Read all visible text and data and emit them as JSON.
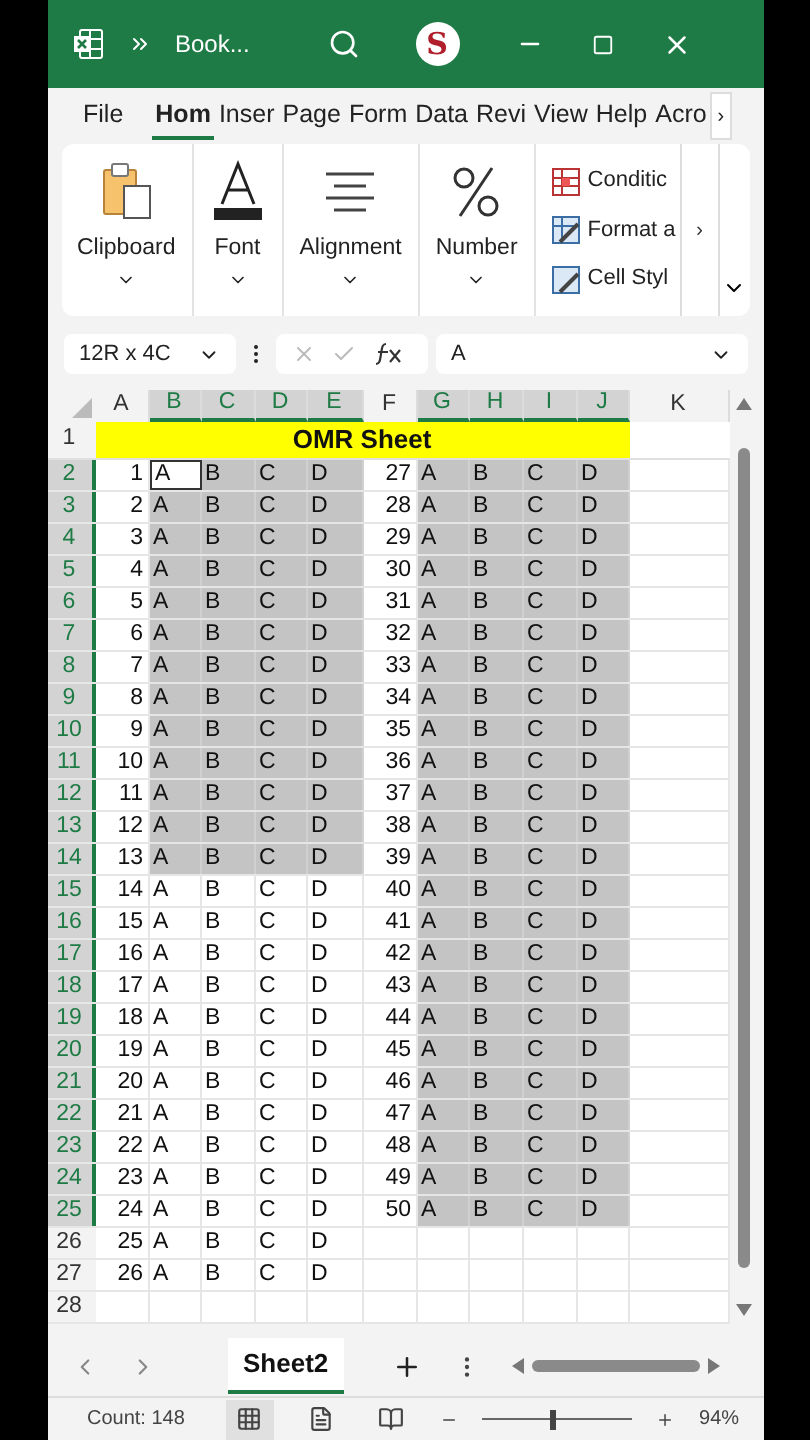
{
  "window": {
    "title": "Book...",
    "avatar": "S"
  },
  "tabs": [
    {
      "label": "File",
      "selected": false
    },
    {
      "label": "Hom",
      "selected": true
    },
    {
      "label": "Inser",
      "selected": false
    },
    {
      "label": "Page",
      "selected": false
    },
    {
      "label": "Form",
      "selected": false
    },
    {
      "label": "Data",
      "selected": false
    },
    {
      "label": "Revi",
      "selected": false
    },
    {
      "label": "View",
      "selected": false
    },
    {
      "label": "Help",
      "selected": false
    },
    {
      "label": "Acro",
      "selected": false
    }
  ],
  "tabs_more": "›",
  "ribbon": {
    "groups": [
      {
        "kind": "clipboard",
        "label": "Clipboard"
      },
      {
        "kind": "font",
        "label": "Font"
      },
      {
        "kind": "alignment",
        "label": "Alignment"
      },
      {
        "kind": "number",
        "label": "Number"
      }
    ],
    "styles": [
      {
        "kind": "conditional",
        "label": "Conditic"
      },
      {
        "kind": "table",
        "label": "Format a"
      },
      {
        "kind": "cell",
        "label": "Cell Styl"
      }
    ],
    "more": "›"
  },
  "formula_bar": {
    "name_box": "12R x 4C",
    "value": "A"
  },
  "sheet": {
    "columns": [
      {
        "label": "A",
        "selected": false
      },
      {
        "label": "B",
        "selected": true
      },
      {
        "label": "C",
        "selected": true
      },
      {
        "label": "D",
        "selected": true
      },
      {
        "label": "E",
        "selected": true
      },
      {
        "label": "F",
        "selected": false
      },
      {
        "label": "G",
        "selected": true
      },
      {
        "label": "H",
        "selected": true
      },
      {
        "label": "I",
        "selected": true
      },
      {
        "label": "J",
        "selected": true
      },
      {
        "label": "K",
        "selected": false
      }
    ],
    "title_row": {
      "label": "1",
      "selected": false,
      "text": "OMR Sheet"
    },
    "rows": [
      {
        "label": "2",
        "selected": true,
        "cells": [
          {
            "text": "1",
            "selected": false,
            "active": false
          },
          {
            "text": "A",
            "selected": true,
            "active": true
          },
          {
            "text": "B",
            "selected": true,
            "active": false
          },
          {
            "text": "C",
            "selected": true,
            "active": false
          },
          {
            "text": "D",
            "selected": true,
            "active": false
          },
          {
            "text": "27",
            "selected": false,
            "active": false
          },
          {
            "text": "A",
            "selected": true,
            "active": false
          },
          {
            "text": "B",
            "selected": true,
            "active": false
          },
          {
            "text": "C",
            "selected": true,
            "active": false
          },
          {
            "text": "D",
            "selected": true,
            "active": false
          }
        ]
      },
      {
        "label": "3",
        "selected": true,
        "cells": [
          {
            "text": "2",
            "selected": false,
            "active": false
          },
          {
            "text": "A",
            "selected": true,
            "active": false
          },
          {
            "text": "B",
            "selected": true,
            "active": false
          },
          {
            "text": "C",
            "selected": true,
            "active": false
          },
          {
            "text": "D",
            "selected": true,
            "active": false
          },
          {
            "text": "28",
            "selected": false,
            "active": false
          },
          {
            "text": "A",
            "selected": true,
            "active": false
          },
          {
            "text": "B",
            "selected": true,
            "active": false
          },
          {
            "text": "C",
            "selected": true,
            "active": false
          },
          {
            "text": "D",
            "selected": true,
            "active": false
          }
        ]
      },
      {
        "label": "4",
        "selected": true,
        "cells": [
          {
            "text": "3",
            "selected": false,
            "active": false
          },
          {
            "text": "A",
            "selected": true,
            "active": false
          },
          {
            "text": "B",
            "selected": true,
            "active": false
          },
          {
            "text": "C",
            "selected": true,
            "active": false
          },
          {
            "text": "D",
            "selected": true,
            "active": false
          },
          {
            "text": "29",
            "selected": false,
            "active": false
          },
          {
            "text": "A",
            "selected": true,
            "active": false
          },
          {
            "text": "B",
            "selected": true,
            "active": false
          },
          {
            "text": "C",
            "selected": true,
            "active": false
          },
          {
            "text": "D",
            "selected": true,
            "active": false
          }
        ]
      },
      {
        "label": "5",
        "selected": true,
        "cells": [
          {
            "text": "4",
            "selected": false,
            "active": false
          },
          {
            "text": "A",
            "selected": true,
            "active": false
          },
          {
            "text": "B",
            "selected": true,
            "active": false
          },
          {
            "text": "C",
            "selected": true,
            "active": false
          },
          {
            "text": "D",
            "selected": true,
            "active": false
          },
          {
            "text": "30",
            "selected": false,
            "active": false
          },
          {
            "text": "A",
            "selected": true,
            "active": false
          },
          {
            "text": "B",
            "selected": true,
            "active": false
          },
          {
            "text": "C",
            "selected": true,
            "active": false
          },
          {
            "text": "D",
            "selected": true,
            "active": false
          }
        ]
      },
      {
        "label": "6",
        "selected": true,
        "cells": [
          {
            "text": "5",
            "selected": false,
            "active": false
          },
          {
            "text": "A",
            "selected": true,
            "active": false
          },
          {
            "text": "B",
            "selected": true,
            "active": false
          },
          {
            "text": "C",
            "selected": true,
            "active": false
          },
          {
            "text": "D",
            "selected": true,
            "active": false
          },
          {
            "text": "31",
            "selected": false,
            "active": false
          },
          {
            "text": "A",
            "selected": true,
            "active": false
          },
          {
            "text": "B",
            "selected": true,
            "active": false
          },
          {
            "text": "C",
            "selected": true,
            "active": false
          },
          {
            "text": "D",
            "selected": true,
            "active": false
          }
        ]
      },
      {
        "label": "7",
        "selected": true,
        "cells": [
          {
            "text": "6",
            "selected": false,
            "active": false
          },
          {
            "text": "A",
            "selected": true,
            "active": false
          },
          {
            "text": "B",
            "selected": true,
            "active": false
          },
          {
            "text": "C",
            "selected": true,
            "active": false
          },
          {
            "text": "D",
            "selected": true,
            "active": false
          },
          {
            "text": "32",
            "selected": false,
            "active": false
          },
          {
            "text": "A",
            "selected": true,
            "active": false
          },
          {
            "text": "B",
            "selected": true,
            "active": false
          },
          {
            "text": "C",
            "selected": true,
            "active": false
          },
          {
            "text": "D",
            "selected": true,
            "active": false
          }
        ]
      },
      {
        "label": "8",
        "selected": true,
        "cells": [
          {
            "text": "7",
            "selected": false,
            "active": false
          },
          {
            "text": "A",
            "selected": true,
            "active": false
          },
          {
            "text": "B",
            "selected": true,
            "active": false
          },
          {
            "text": "C",
            "selected": true,
            "active": false
          },
          {
            "text": "D",
            "selected": true,
            "active": false
          },
          {
            "text": "33",
            "selected": false,
            "active": false
          },
          {
            "text": "A",
            "selected": true,
            "active": false
          },
          {
            "text": "B",
            "selected": true,
            "active": false
          },
          {
            "text": "C",
            "selected": true,
            "active": false
          },
          {
            "text": "D",
            "selected": true,
            "active": false
          }
        ]
      },
      {
        "label": "9",
        "selected": true,
        "cells": [
          {
            "text": "8",
            "selected": false,
            "active": false
          },
          {
            "text": "A",
            "selected": true,
            "active": false
          },
          {
            "text": "B",
            "selected": true,
            "active": false
          },
          {
            "text": "C",
            "selected": true,
            "active": false
          },
          {
            "text": "D",
            "selected": true,
            "active": false
          },
          {
            "text": "34",
            "selected": false,
            "active": false
          },
          {
            "text": "A",
            "selected": true,
            "active": false
          },
          {
            "text": "B",
            "selected": true,
            "active": false
          },
          {
            "text": "C",
            "selected": true,
            "active": false
          },
          {
            "text": "D",
            "selected": true,
            "active": false
          }
        ]
      },
      {
        "label": "10",
        "selected": true,
        "cells": [
          {
            "text": "9",
            "selected": false,
            "active": false
          },
          {
            "text": "A",
            "selected": true,
            "active": false
          },
          {
            "text": "B",
            "selected": true,
            "active": false
          },
          {
            "text": "C",
            "selected": true,
            "active": false
          },
          {
            "text": "D",
            "selected": true,
            "active": false
          },
          {
            "text": "35",
            "selected": false,
            "active": false
          },
          {
            "text": "A",
            "selected": true,
            "active": false
          },
          {
            "text": "B",
            "selected": true,
            "active": false
          },
          {
            "text": "C",
            "selected": true,
            "active": false
          },
          {
            "text": "D",
            "selected": true,
            "active": false
          }
        ]
      },
      {
        "label": "11",
        "selected": true,
        "cells": [
          {
            "text": "10",
            "selected": false,
            "active": false
          },
          {
            "text": "A",
            "selected": true,
            "active": false
          },
          {
            "text": "B",
            "selected": true,
            "active": false
          },
          {
            "text": "C",
            "selected": true,
            "active": false
          },
          {
            "text": "D",
            "selected": true,
            "active": false
          },
          {
            "text": "36",
            "selected": false,
            "active": false
          },
          {
            "text": "A",
            "selected": true,
            "active": false
          },
          {
            "text": "B",
            "selected": true,
            "active": false
          },
          {
            "text": "C",
            "selected": true,
            "active": false
          },
          {
            "text": "D",
            "selected": true,
            "active": false
          }
        ]
      },
      {
        "label": "12",
        "selected": true,
        "cells": [
          {
            "text": "11",
            "selected": false,
            "active": false
          },
          {
            "text": "A",
            "selected": true,
            "active": false
          },
          {
            "text": "B",
            "selected": true,
            "active": false
          },
          {
            "text": "C",
            "selected": true,
            "active": false
          },
          {
            "text": "D",
            "selected": true,
            "active": false
          },
          {
            "text": "37",
            "selected": false,
            "active": false
          },
          {
            "text": "A",
            "selected": true,
            "active": false
          },
          {
            "text": "B",
            "selected": true,
            "active": false
          },
          {
            "text": "C",
            "selected": true,
            "active": false
          },
          {
            "text": "D",
            "selected": true,
            "active": false
          }
        ]
      },
      {
        "label": "13",
        "selected": true,
        "cells": [
          {
            "text": "12",
            "selected": false,
            "active": false
          },
          {
            "text": "A",
            "selected": true,
            "active": false
          },
          {
            "text": "B",
            "selected": true,
            "active": false
          },
          {
            "text": "C",
            "selected": true,
            "active": false
          },
          {
            "text": "D",
            "selected": true,
            "active": false
          },
          {
            "text": "38",
            "selected": false,
            "active": false
          },
          {
            "text": "A",
            "selected": true,
            "active": false
          },
          {
            "text": "B",
            "selected": true,
            "active": false
          },
          {
            "text": "C",
            "selected": true,
            "active": false
          },
          {
            "text": "D",
            "selected": true,
            "active": false
          }
        ]
      },
      {
        "label": "14",
        "selected": true,
        "cells": [
          {
            "text": "13",
            "selected": false,
            "active": false
          },
          {
            "text": "A",
            "selected": true,
            "active": false
          },
          {
            "text": "B",
            "selected": true,
            "active": false
          },
          {
            "text": "C",
            "selected": true,
            "active": false
          },
          {
            "text": "D",
            "selected": true,
            "active": false
          },
          {
            "text": "39",
            "selected": false,
            "active": false
          },
          {
            "text": "A",
            "selected": true,
            "active": false
          },
          {
            "text": "B",
            "selected": true,
            "active": false
          },
          {
            "text": "C",
            "selected": true,
            "active": false
          },
          {
            "text": "D",
            "selected": true,
            "active": false
          }
        ]
      },
      {
        "label": "15",
        "selected": true,
        "cells": [
          {
            "text": "14",
            "selected": false,
            "active": false
          },
          {
            "text": "A",
            "selected": false,
            "active": false
          },
          {
            "text": "B",
            "selected": false,
            "active": false
          },
          {
            "text": "C",
            "selected": false,
            "active": false
          },
          {
            "text": "D",
            "selected": false,
            "active": false
          },
          {
            "text": "40",
            "selected": false,
            "active": false
          },
          {
            "text": "A",
            "selected": true,
            "active": false
          },
          {
            "text": "B",
            "selected": true,
            "active": false
          },
          {
            "text": "C",
            "selected": true,
            "active": false
          },
          {
            "text": "D",
            "selected": true,
            "active": false
          }
        ]
      },
      {
        "label": "16",
        "selected": true,
        "cells": [
          {
            "text": "15",
            "selected": false,
            "active": false
          },
          {
            "text": "A",
            "selected": false,
            "active": false
          },
          {
            "text": "B",
            "selected": false,
            "active": false
          },
          {
            "text": "C",
            "selected": false,
            "active": false
          },
          {
            "text": "D",
            "selected": false,
            "active": false
          },
          {
            "text": "41",
            "selected": false,
            "active": false
          },
          {
            "text": "A",
            "selected": true,
            "active": false
          },
          {
            "text": "B",
            "selected": true,
            "active": false
          },
          {
            "text": "C",
            "selected": true,
            "active": false
          },
          {
            "text": "D",
            "selected": true,
            "active": false
          }
        ]
      },
      {
        "label": "17",
        "selected": true,
        "cells": [
          {
            "text": "16",
            "selected": false,
            "active": false
          },
          {
            "text": "A",
            "selected": false,
            "active": false
          },
          {
            "text": "B",
            "selected": false,
            "active": false
          },
          {
            "text": "C",
            "selected": false,
            "active": false
          },
          {
            "text": "D",
            "selected": false,
            "active": false
          },
          {
            "text": "42",
            "selected": false,
            "active": false
          },
          {
            "text": "A",
            "selected": true,
            "active": false
          },
          {
            "text": "B",
            "selected": true,
            "active": false
          },
          {
            "text": "C",
            "selected": true,
            "active": false
          },
          {
            "text": "D",
            "selected": true,
            "active": false
          }
        ]
      },
      {
        "label": "18",
        "selected": true,
        "cells": [
          {
            "text": "17",
            "selected": false,
            "active": false
          },
          {
            "text": "A",
            "selected": false,
            "active": false
          },
          {
            "text": "B",
            "selected": false,
            "active": false
          },
          {
            "text": "C",
            "selected": false,
            "active": false
          },
          {
            "text": "D",
            "selected": false,
            "active": false
          },
          {
            "text": "43",
            "selected": false,
            "active": false
          },
          {
            "text": "A",
            "selected": true,
            "active": false
          },
          {
            "text": "B",
            "selected": true,
            "active": false
          },
          {
            "text": "C",
            "selected": true,
            "active": false
          },
          {
            "text": "D",
            "selected": true,
            "active": false
          }
        ]
      },
      {
        "label": "19",
        "selected": true,
        "cells": [
          {
            "text": "18",
            "selected": false,
            "active": false
          },
          {
            "text": "A",
            "selected": false,
            "active": false
          },
          {
            "text": "B",
            "selected": false,
            "active": false
          },
          {
            "text": "C",
            "selected": false,
            "active": false
          },
          {
            "text": "D",
            "selected": false,
            "active": false
          },
          {
            "text": "44",
            "selected": false,
            "active": false
          },
          {
            "text": "A",
            "selected": true,
            "active": false
          },
          {
            "text": "B",
            "selected": true,
            "active": false
          },
          {
            "text": "C",
            "selected": true,
            "active": false
          },
          {
            "text": "D",
            "selected": true,
            "active": false
          }
        ]
      },
      {
        "label": "20",
        "selected": true,
        "cells": [
          {
            "text": "19",
            "selected": false,
            "active": false
          },
          {
            "text": "A",
            "selected": false,
            "active": false
          },
          {
            "text": "B",
            "selected": false,
            "active": false
          },
          {
            "text": "C",
            "selected": false,
            "active": false
          },
          {
            "text": "D",
            "selected": false,
            "active": false
          },
          {
            "text": "45",
            "selected": false,
            "active": false
          },
          {
            "text": "A",
            "selected": true,
            "active": false
          },
          {
            "text": "B",
            "selected": true,
            "active": false
          },
          {
            "text": "C",
            "selected": true,
            "active": false
          },
          {
            "text": "D",
            "selected": true,
            "active": false
          }
        ]
      },
      {
        "label": "21",
        "selected": true,
        "cells": [
          {
            "text": "20",
            "selected": false,
            "active": false
          },
          {
            "text": "A",
            "selected": false,
            "active": false
          },
          {
            "text": "B",
            "selected": false,
            "active": false
          },
          {
            "text": "C",
            "selected": false,
            "active": false
          },
          {
            "text": "D",
            "selected": false,
            "active": false
          },
          {
            "text": "46",
            "selected": false,
            "active": false
          },
          {
            "text": "A",
            "selected": true,
            "active": false
          },
          {
            "text": "B",
            "selected": true,
            "active": false
          },
          {
            "text": "C",
            "selected": true,
            "active": false
          },
          {
            "text": "D",
            "selected": true,
            "active": false
          }
        ]
      },
      {
        "label": "22",
        "selected": true,
        "cells": [
          {
            "text": "21",
            "selected": false,
            "active": false
          },
          {
            "text": "A",
            "selected": false,
            "active": false
          },
          {
            "text": "B",
            "selected": false,
            "active": false
          },
          {
            "text": "C",
            "selected": false,
            "active": false
          },
          {
            "text": "D",
            "selected": false,
            "active": false
          },
          {
            "text": "47",
            "selected": false,
            "active": false
          },
          {
            "text": "A",
            "selected": true,
            "active": false
          },
          {
            "text": "B",
            "selected": true,
            "active": false
          },
          {
            "text": "C",
            "selected": true,
            "active": false
          },
          {
            "text": "D",
            "selected": true,
            "active": false
          }
        ]
      },
      {
        "label": "23",
        "selected": true,
        "cells": [
          {
            "text": "22",
            "selected": false,
            "active": false
          },
          {
            "text": "A",
            "selected": false,
            "active": false
          },
          {
            "text": "B",
            "selected": false,
            "active": false
          },
          {
            "text": "C",
            "selected": false,
            "active": false
          },
          {
            "text": "D",
            "selected": false,
            "active": false
          },
          {
            "text": "48",
            "selected": false,
            "active": false
          },
          {
            "text": "A",
            "selected": true,
            "active": false
          },
          {
            "text": "B",
            "selected": true,
            "active": false
          },
          {
            "text": "C",
            "selected": true,
            "active": false
          },
          {
            "text": "D",
            "selected": true,
            "active": false
          }
        ]
      },
      {
        "label": "24",
        "selected": true,
        "cells": [
          {
            "text": "23",
            "selected": false,
            "active": false
          },
          {
            "text": "A",
            "selected": false,
            "active": false
          },
          {
            "text": "B",
            "selected": false,
            "active": false
          },
          {
            "text": "C",
            "selected": false,
            "active": false
          },
          {
            "text": "D",
            "selected": false,
            "active": false
          },
          {
            "text": "49",
            "selected": false,
            "active": false
          },
          {
            "text": "A",
            "selected": true,
            "active": false
          },
          {
            "text": "B",
            "selected": true,
            "active": false
          },
          {
            "text": "C",
            "selected": true,
            "active": false
          },
          {
            "text": "D",
            "selected": true,
            "active": false
          }
        ]
      },
      {
        "label": "25",
        "selected": true,
        "cells": [
          {
            "text": "24",
            "selected": false,
            "active": false
          },
          {
            "text": "A",
            "selected": false,
            "active": false
          },
          {
            "text": "B",
            "selected": false,
            "active": false
          },
          {
            "text": "C",
            "selected": false,
            "active": false
          },
          {
            "text": "D",
            "selected": false,
            "active": false
          },
          {
            "text": "50",
            "selected": false,
            "active": false
          },
          {
            "text": "A",
            "selected": true,
            "active": false
          },
          {
            "text": "B",
            "selected": true,
            "active": false
          },
          {
            "text": "C",
            "selected": true,
            "active": false
          },
          {
            "text": "D",
            "selected": true,
            "active": false
          }
        ]
      },
      {
        "label": "26",
        "selected": false,
        "cells": [
          {
            "text": "25",
            "selected": false,
            "active": false
          },
          {
            "text": "A",
            "selected": false,
            "active": false
          },
          {
            "text": "B",
            "selected": false,
            "active": false
          },
          {
            "text": "C",
            "selected": false,
            "active": false
          },
          {
            "text": "D",
            "selected": false,
            "active": false
          }
        ]
      },
      {
        "label": "27",
        "selected": false,
        "cells": [
          {
            "text": "26",
            "selected": false,
            "active": false
          },
          {
            "text": "A",
            "selected": false,
            "active": false
          },
          {
            "text": "B",
            "selected": false,
            "active": false
          },
          {
            "text": "C",
            "selected": false,
            "active": false
          },
          {
            "text": "D",
            "selected": false,
            "active": false
          }
        ]
      },
      {
        "label": "28",
        "selected": false
      }
    ]
  },
  "sheet_tabs": [
    {
      "label": "Sheet2",
      "selected": true
    }
  ],
  "status_bar": {
    "count": "Count: 148",
    "views": [
      {
        "kind": "normal",
        "selected": true
      },
      {
        "kind": "page_layout",
        "selected": false
      },
      {
        "kind": "page_break",
        "selected": false
      }
    ],
    "zoom": {
      "level": 0.45,
      "reading": "94%"
    }
  }
}
